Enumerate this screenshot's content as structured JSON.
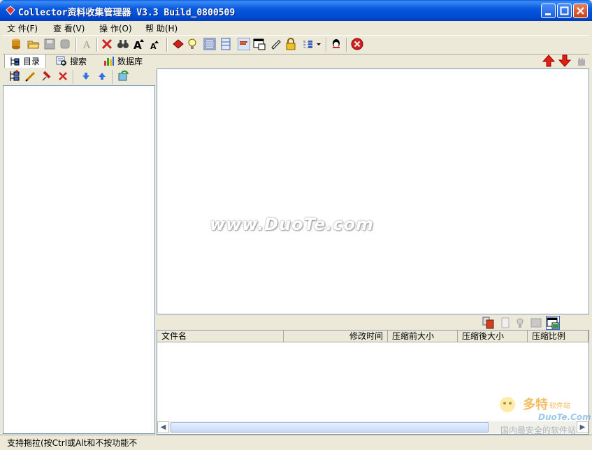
{
  "window": {
    "title": "Collector资料收集管理器 V3.3 Build_0800509"
  },
  "menu": [
    {
      "label": "文 件(F)"
    },
    {
      "label": "查 看(V)"
    },
    {
      "label": "操 作(O)"
    },
    {
      "label": "帮 助(H)"
    }
  ],
  "toolbar_icons": [
    "database-icon",
    "open-folder-icon",
    "save-icon",
    "cylinder-icon",
    "font-icon",
    "delete-icon",
    "find-icon",
    "font-larger-icon",
    "font-smaller-icon",
    "bookmark-icon",
    "lightbulb-icon",
    "page-view-icon",
    "split-view-icon",
    "brush-icon",
    "window-icon",
    "edit-icon",
    "lock-icon",
    "tree-icon",
    "dropdown-icon",
    "qq-icon",
    "stop-icon"
  ],
  "left_tabs": [
    {
      "label": "目录",
      "icon": "directory-tree-icon",
      "active": true
    },
    {
      "label": "搜索",
      "icon": "search-icon",
      "active": false
    },
    {
      "label": "数据库",
      "icon": "database-chart-icon",
      "active": false
    }
  ],
  "left_toolbar_icons": [
    "new-folder-icon",
    "rename-icon",
    "pin-icon",
    "delete-icon",
    "move-down-icon",
    "move-up-icon",
    "refresh-icon"
  ],
  "nav_icons": [
    "arrow-up-icon",
    "arrow-down-icon",
    "hand-icon"
  ],
  "watermark": "www.DuoTe.com",
  "file_list": {
    "columns": [
      "文件名",
      "修改时间",
      "压缩前大小",
      "压缩後大小",
      "压缩比例"
    ]
  },
  "status": {
    "text": "支持拖拉(按Ctrl或Alt和不按功能不"
  },
  "brand": {
    "name": "多特",
    "sub": "软件站",
    "url": "DuoTe.Com",
    "slogan": "国内最安全的软件站"
  },
  "colors": {
    "titlebar": "#0054e3",
    "background": "#ece9d8",
    "close_red": "#d32f2f"
  }
}
